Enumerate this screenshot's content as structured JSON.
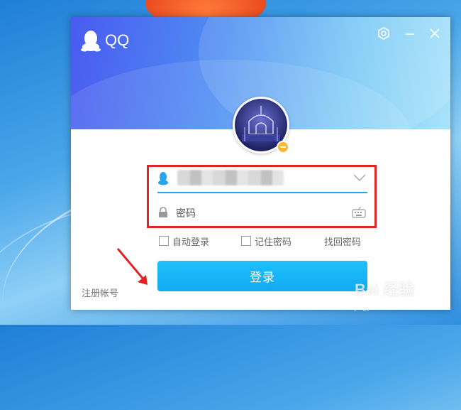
{
  "app": {
    "logo_text": "QQ"
  },
  "window_controls": {
    "settings_icon": "gear-icon",
    "minimize_icon": "minimize-icon",
    "close_icon": "close-icon"
  },
  "avatar": {
    "status": "away",
    "status_color": "#f7b731"
  },
  "account_field": {
    "value": "",
    "dropdown_icon": "chevron-down-icon"
  },
  "password_field": {
    "placeholder": "密码",
    "lock_icon": "lock-icon",
    "keyboard_icon": "keyboard-icon"
  },
  "options": {
    "auto_login_label": "自动登录",
    "remember_password_label": "记住密码",
    "retrieve_password_label": "找回密码"
  },
  "login_button": {
    "label": "登录",
    "color": "#12aaf1"
  },
  "register_link": {
    "label": "注册帐号"
  },
  "annotation": {
    "highlight_color": "#e02424",
    "arrow_color": "#e02424"
  },
  "watermark": {
    "logo_text": "Bai 经验",
    "url": "jingyan.baidu.com"
  }
}
